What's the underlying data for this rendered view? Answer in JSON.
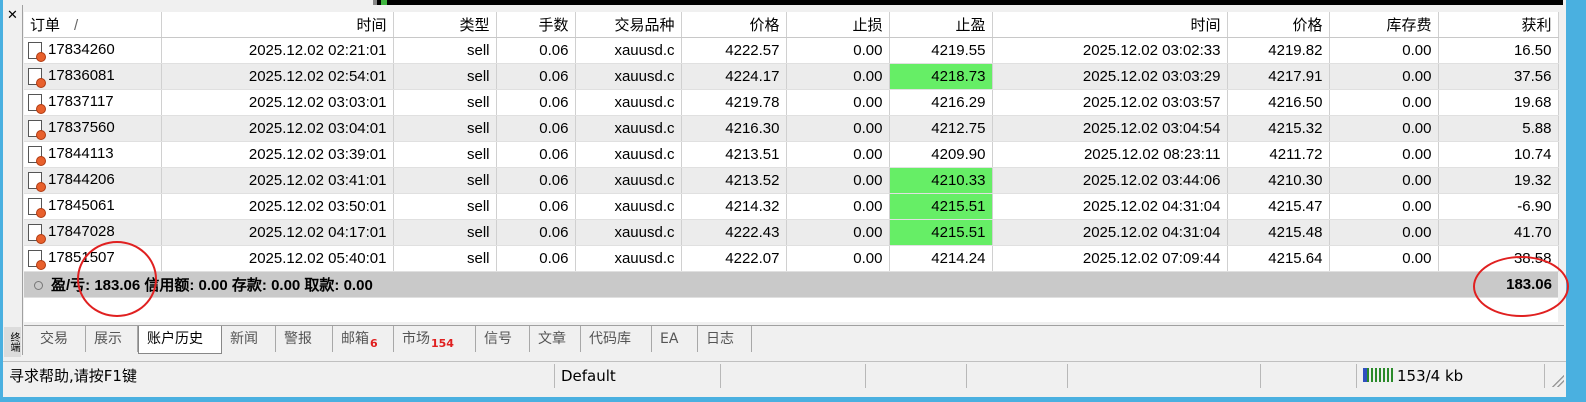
{
  "panel": {
    "close_icon": "close-icon",
    "side_label": "终端"
  },
  "columns": [
    "订单",
    "时间",
    "类型",
    "手数",
    "交易品种",
    "价格",
    "止损",
    "止盈",
    "时间",
    "价格",
    "库存费",
    "获利"
  ],
  "sort_indicator": "/",
  "rows": [
    {
      "order": "17834260",
      "open_time": "2025.12.02 02:21:01",
      "type": "sell",
      "lots": "0.06",
      "symbol": "xauusd.c",
      "open_price": "4222.57",
      "sl": "0.00",
      "tp": "4219.55",
      "tp_hit": false,
      "close_time": "2025.12.02 03:02:33",
      "close_price": "4219.82",
      "swap": "0.00",
      "profit": "16.50"
    },
    {
      "order": "17836081",
      "open_time": "2025.12.02 02:54:01",
      "type": "sell",
      "lots": "0.06",
      "symbol": "xauusd.c",
      "open_price": "4224.17",
      "sl": "0.00",
      "tp": "4218.73",
      "tp_hit": true,
      "close_time": "2025.12.02 03:03:29",
      "close_price": "4217.91",
      "swap": "0.00",
      "profit": "37.56"
    },
    {
      "order": "17837117",
      "open_time": "2025.12.02 03:03:01",
      "type": "sell",
      "lots": "0.06",
      "symbol": "xauusd.c",
      "open_price": "4219.78",
      "sl": "0.00",
      "tp": "4216.29",
      "tp_hit": false,
      "close_time": "2025.12.02 03:03:57",
      "close_price": "4216.50",
      "swap": "0.00",
      "profit": "19.68"
    },
    {
      "order": "17837560",
      "open_time": "2025.12.02 03:04:01",
      "type": "sell",
      "lots": "0.06",
      "symbol": "xauusd.c",
      "open_price": "4216.30",
      "sl": "0.00",
      "tp": "4212.75",
      "tp_hit": false,
      "close_time": "2025.12.02 03:04:54",
      "close_price": "4215.32",
      "swap": "0.00",
      "profit": "5.88"
    },
    {
      "order": "17844113",
      "open_time": "2025.12.02 03:39:01",
      "type": "sell",
      "lots": "0.06",
      "symbol": "xauusd.c",
      "open_price": "4213.51",
      "sl": "0.00",
      "tp": "4209.90",
      "tp_hit": false,
      "close_time": "2025.12.02 08:23:11",
      "close_price": "4211.72",
      "swap": "0.00",
      "profit": "10.74"
    },
    {
      "order": "17844206",
      "open_time": "2025.12.02 03:41:01",
      "type": "sell",
      "lots": "0.06",
      "symbol": "xauusd.c",
      "open_price": "4213.52",
      "sl": "0.00",
      "tp": "4210.33",
      "tp_hit": true,
      "close_time": "2025.12.02 03:44:06",
      "close_price": "4210.30",
      "swap": "0.00",
      "profit": "19.32"
    },
    {
      "order": "17845061",
      "open_time": "2025.12.02 03:50:01",
      "type": "sell",
      "lots": "0.06",
      "symbol": "xauusd.c",
      "open_price": "4214.32",
      "sl": "0.00",
      "tp": "4215.51",
      "tp_hit": true,
      "close_time": "2025.12.02 04:31:04",
      "close_price": "4215.47",
      "swap": "0.00",
      "profit": "-6.90"
    },
    {
      "order": "17847028",
      "open_time": "2025.12.02 04:17:01",
      "type": "sell",
      "lots": "0.06",
      "symbol": "xauusd.c",
      "open_price": "4222.43",
      "sl": "0.00",
      "tp": "4215.51",
      "tp_hit": true,
      "close_time": "2025.12.02 04:31:04",
      "close_price": "4215.48",
      "swap": "0.00",
      "profit": "41.70"
    },
    {
      "order": "17851507",
      "open_time": "2025.12.02 05:40:01",
      "type": "sell",
      "lots": "0.06",
      "symbol": "xauusd.c",
      "open_price": "4222.07",
      "sl": "0.00",
      "tp": "4214.24",
      "tp_hit": false,
      "close_time": "2025.12.02 07:09:44",
      "close_price": "4215.64",
      "swap": "0.00",
      "profit": "38.58"
    }
  ],
  "summary": {
    "text": "盈/亏: 183.06  信用额: 0.00  存款: 0.00  取款: 0.00",
    "total": "183.06"
  },
  "tabs": [
    {
      "label": "交易",
      "badge": ""
    },
    {
      "label": "展示",
      "badge": ""
    },
    {
      "label": "账户历史",
      "badge": "",
      "active": true
    },
    {
      "label": "新闻",
      "badge": ""
    },
    {
      "label": "警报",
      "badge": ""
    },
    {
      "label": "邮箱",
      "badge": "6"
    },
    {
      "label": "市场",
      "badge": "154"
    },
    {
      "label": "信号",
      "badge": ""
    },
    {
      "label": "文章",
      "badge": ""
    },
    {
      "label": "代码库",
      "badge": ""
    },
    {
      "label": "EA",
      "badge": ""
    },
    {
      "label": "日志",
      "badge": ""
    }
  ],
  "statusbar": {
    "help": "寻求帮助,请按F1键",
    "profile": "Default",
    "connection": "153/4 kb"
  },
  "colors": {
    "tp_highlight": "#66ee66",
    "annotation": "#e02020",
    "badge": "#e02020"
  }
}
